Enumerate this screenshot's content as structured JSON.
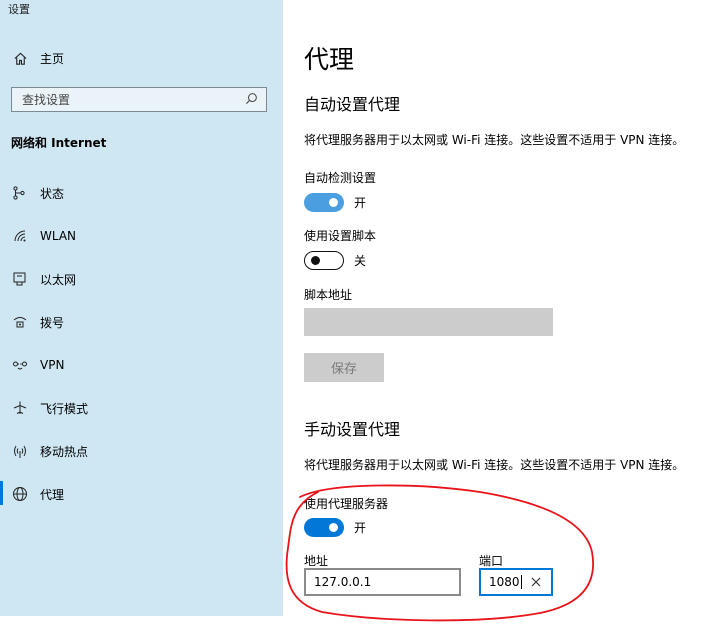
{
  "window": {
    "title": "设置"
  },
  "sidebar": {
    "home_label": "主页",
    "search_placeholder": "查找设置",
    "section_title": "网络和 Internet",
    "items": [
      {
        "label": "状态",
        "icon": "status-icon"
      },
      {
        "label": "WLAN",
        "icon": "wifi-icon"
      },
      {
        "label": "以太网",
        "icon": "ethernet-icon"
      },
      {
        "label": "拨号",
        "icon": "dialup-icon"
      },
      {
        "label": "VPN",
        "icon": "vpn-icon"
      },
      {
        "label": "飞行模式",
        "icon": "airplane-icon"
      },
      {
        "label": "移动热点",
        "icon": "hotspot-icon"
      },
      {
        "label": "代理",
        "icon": "globe-icon",
        "active": true
      }
    ]
  },
  "main": {
    "title": "代理",
    "auto": {
      "heading": "自动设置代理",
      "description": "将代理服务器用于以太网或 Wi-Fi 连接。这些设置不适用于 VPN 连接。",
      "detect_label": "自动检测设置",
      "detect_state": "开",
      "script_label": "使用设置脚本",
      "script_state": "关",
      "script_address_label": "脚本地址",
      "script_address_value": "",
      "save_label": "保存"
    },
    "manual": {
      "heading": "手动设置代理",
      "description": "将代理服务器用于以太网或 Wi-Fi 连接。这些设置不适用于 VPN 连接。",
      "use_proxy_label": "使用代理服务器",
      "use_proxy_state": "开",
      "address_label": "地址",
      "address_value": "127.0.0.1",
      "port_label": "端口",
      "port_value": "1080"
    }
  },
  "colors": {
    "sidebar_bg": "#cfe7f3",
    "accent": "#0078d7",
    "annotation": "#e8141b"
  }
}
